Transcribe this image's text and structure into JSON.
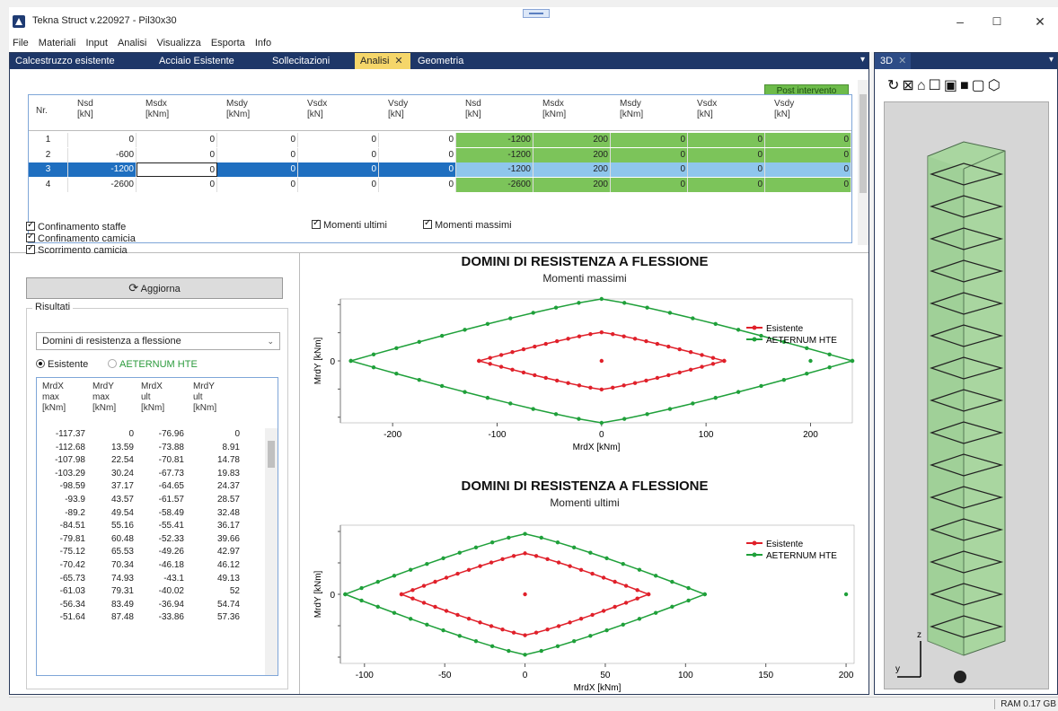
{
  "window": {
    "title": "Tekna Struct v.220927 - Pil30x30"
  },
  "menu": [
    "File",
    "Materiali",
    "Input",
    "Analisi",
    "Visualizza",
    "Esporta",
    "Info"
  ],
  "tabs": [
    {
      "label": "Calcestruzzo esistente"
    },
    {
      "label": "Acciaio Esistente"
    },
    {
      "label": "Sollecitazioni"
    },
    {
      "label": "Analisi"
    },
    {
      "label": "Geometria"
    }
  ],
  "side_tab": {
    "label": "3D"
  },
  "post_button": "Post intervento",
  "table": {
    "headers": [
      [
        "Nr.",
        ""
      ],
      [
        "Nsd",
        "[kN]"
      ],
      [
        "Msdx",
        "[kNm]"
      ],
      [
        "Msdy",
        "[kNm]"
      ],
      [
        "Vsdx",
        "[kN]"
      ],
      [
        "Vsdy",
        "[kN]"
      ],
      [
        "Nsd",
        "[kN]"
      ],
      [
        "Msdx",
        "[kNm]"
      ],
      [
        "Msdy",
        "[kNm]"
      ],
      [
        "Vsdx",
        "[kN]"
      ],
      [
        "Vsdy",
        "[kN]"
      ]
    ],
    "rows": [
      [
        "1",
        "0",
        "0",
        "0",
        "0",
        "0",
        "-1200",
        "200",
        "0",
        "0",
        "0"
      ],
      [
        "2",
        "-600",
        "0",
        "0",
        "0",
        "0",
        "-1200",
        "200",
        "0",
        "0",
        "0"
      ],
      [
        "3",
        "-1200",
        "0",
        "0",
        "0",
        "0",
        "-1200",
        "200",
        "0",
        "0",
        "0"
      ],
      [
        "4",
        "-2600",
        "0",
        "0",
        "0",
        "0",
        "-2600",
        "200",
        "0",
        "0",
        "0"
      ]
    ]
  },
  "options": {
    "confinamento_staffe": "Confinamento staffe",
    "confinamento_camicia": "Confinamento camicia",
    "scorrimento_camicia": "Scorrimento camicia",
    "aggiorna": "Aggiorna"
  },
  "results": {
    "group_title": "Risultati",
    "combo_value": "Domini di resistenza a flessione",
    "radio_existing": "Esistente",
    "radio_aeternum": "AETERNUM HTE",
    "headers": [
      [
        "MrdX",
        "max",
        "[kNm]"
      ],
      [
        "MrdY",
        "max",
        "[kNm]"
      ],
      [
        "MrdX",
        "ult",
        "[kNm]"
      ],
      [
        "MrdY",
        "ult",
        "[kNm]"
      ]
    ],
    "rows": [
      [
        "-117.37",
        "0",
        "-76.96",
        "0"
      ],
      [
        "-112.68",
        "13.59",
        "-73.88",
        "8.91"
      ],
      [
        "-107.98",
        "22.54",
        "-70.81",
        "14.78"
      ],
      [
        "-103.29",
        "30.24",
        "-67.73",
        "19.83"
      ],
      [
        "-98.59",
        "37.17",
        "-64.65",
        "24.37"
      ],
      [
        "-93.9",
        "43.57",
        "-61.57",
        "28.57"
      ],
      [
        "-89.2",
        "49.54",
        "-58.49",
        "32.48"
      ],
      [
        "-84.51",
        "55.16",
        "-55.41",
        "36.17"
      ],
      [
        "-79.81",
        "60.48",
        "-52.33",
        "39.66"
      ],
      [
        "-75.12",
        "65.53",
        "-49.26",
        "42.97"
      ],
      [
        "-70.42",
        "70.34",
        "-46.18",
        "46.12"
      ],
      [
        "-65.73",
        "74.93",
        "-43.1",
        "49.13"
      ],
      [
        "-61.03",
        "79.31",
        "-40.02",
        "52"
      ],
      [
        "-56.34",
        "83.49",
        "-36.94",
        "54.74"
      ],
      [
        "-51.64",
        "87.48",
        "-33.86",
        "57.36"
      ]
    ]
  },
  "chart_toggles": {
    "ultimi": "Momenti ultimi",
    "massimi": "Momenti massimi"
  },
  "chart_data": [
    {
      "type": "scatter",
      "title": "DOMINI DI RESISTENZA A FLESSIONE",
      "subtitle": "Momenti massimi",
      "xlabel": "MrdX [kNm]",
      "ylabel": "MrdY [kNm]",
      "xlim": [
        -250,
        240
      ],
      "xticks": [
        "-200",
        "-100",
        "0",
        "100",
        "200"
      ],
      "yticks": [
        "0"
      ],
      "legend": "top-right",
      "series": [
        {
          "name": "Esistente",
          "color": "#e0202a",
          "xmin": -117.37,
          "xmax": 117.37,
          "ymax": 120,
          "point": [
            0,
            0
          ]
        },
        {
          "name": "AETERNUM HTE",
          "color": "#1fa03a",
          "xmin": -240,
          "xmax": 240,
          "ymax": 260,
          "point": [
            200,
            0
          ]
        }
      ]
    },
    {
      "type": "scatter",
      "title": "DOMINI DI RESISTENZA A FLESSIONE",
      "subtitle": "Momenti ultimi",
      "xlabel": "MrdX [kNm]",
      "ylabel": "MrdY [kNm]",
      "xlim": [
        -115,
        205
      ],
      "xticks": [
        "-100",
        "-50",
        "0",
        "50",
        "100",
        "150",
        "200"
      ],
      "yticks": [
        "0"
      ],
      "legend": "top-right",
      "series": [
        {
          "name": "Esistente",
          "color": "#e0202a",
          "xmin": -76.96,
          "xmax": 76.96,
          "ymax": 80,
          "point": [
            0,
            0
          ]
        },
        {
          "name": "AETERNUM HTE",
          "color": "#1fa03a",
          "xmin": -112,
          "xmax": 112,
          "ymax": 118,
          "point": [
            200,
            0
          ]
        }
      ]
    }
  ],
  "status": {
    "ram": "RAM 0.17 GB"
  },
  "view3d": {
    "icons": [
      "refresh-icon",
      "view-iso-icon",
      "view-top-icon",
      "view-front-icon",
      "view-side-icon",
      "view-solid-icon",
      "view-wire-icon",
      "view-perspective-icon"
    ]
  }
}
